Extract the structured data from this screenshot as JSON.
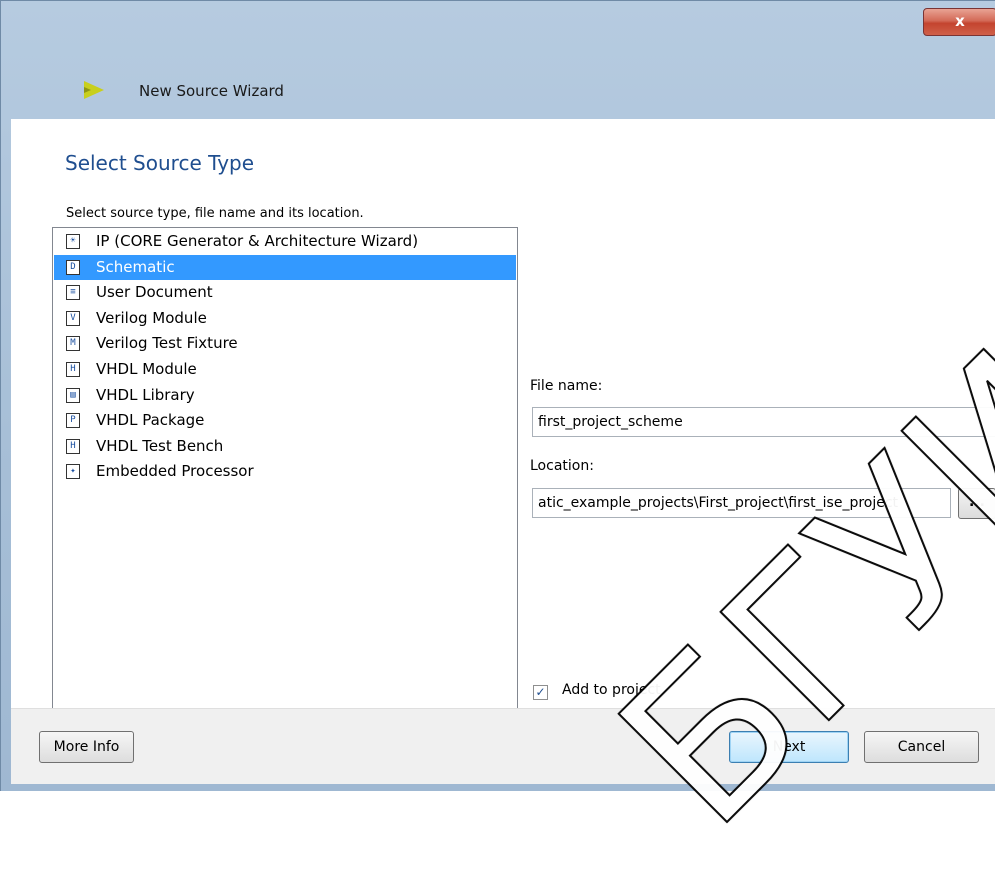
{
  "window": {
    "title": "New Source Wizard",
    "close_glyph": "x"
  },
  "page": {
    "heading": "Select Source Type",
    "instruction": "Select source type, file name and its location."
  },
  "source_types": [
    {
      "label": "IP (CORE Generator & Architecture Wizard)",
      "icon": "lightbulb-icon",
      "glyph": "☀",
      "selected": false
    },
    {
      "label": "Schematic",
      "icon": "schematic-icon",
      "glyph": "D",
      "selected": true
    },
    {
      "label": "User Document",
      "icon": "document-icon",
      "glyph": "≡",
      "selected": false
    },
    {
      "label": "Verilog Module",
      "icon": "verilog-module-icon",
      "glyph": "V",
      "selected": false
    },
    {
      "label": "Verilog Test Fixture",
      "icon": "verilog-test-fixture-icon",
      "glyph": "M",
      "selected": false
    },
    {
      "label": "VHDL Module",
      "icon": "vhdl-module-icon",
      "glyph": "H",
      "selected": false
    },
    {
      "label": "VHDL Library",
      "icon": "vhdl-library-icon",
      "glyph": "▤",
      "selected": false
    },
    {
      "label": "VHDL Package",
      "icon": "vhdl-package-icon",
      "glyph": "P",
      "selected": false
    },
    {
      "label": "VHDL Test Bench",
      "icon": "vhdl-test-bench-icon",
      "glyph": "H",
      "selected": false
    },
    {
      "label": "Embedded Processor",
      "icon": "embedded-processor-icon",
      "glyph": "✦",
      "selected": false
    }
  ],
  "form": {
    "file_name_label": "File name:",
    "file_name_value": "first_project_scheme",
    "location_label": "Location:",
    "location_value": "atic_example_projects\\First_project\\first_ise_project",
    "browse_label": "...",
    "add_to_project_label": "Add to project",
    "add_to_project_checked": true
  },
  "buttons": {
    "more_info": "More Info",
    "next": "Next",
    "cancel": "Cancel"
  },
  "watermark": {
    "text": "БГУИР"
  },
  "colors": {
    "selection": "#3399ff",
    "heading": "#1f4e8f",
    "title_bar": "#a7bfd7",
    "close_button": "#c4442f"
  }
}
